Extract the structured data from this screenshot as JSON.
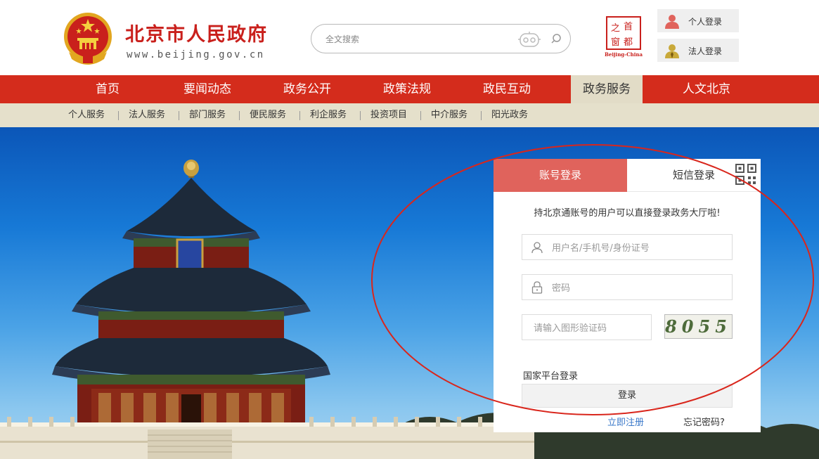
{
  "header": {
    "site_title": "北京市人民政府",
    "site_url": "www.beijing.gov.cn",
    "search_placeholder": "全文搜索",
    "personal_login": "个人登录",
    "corporate_login": "法人登录",
    "capital_logo": {
      "chars": [
        "之",
        "首",
        "窗",
        "都"
      ],
      "caption": "Beijing-China"
    }
  },
  "nav": {
    "items": [
      "首页",
      "要闻动态",
      "政务公开",
      "政策法规",
      "政民互动",
      "政务服务",
      "人文北京"
    ],
    "active": "政务服务"
  },
  "subnav": {
    "items": [
      "个人服务",
      "法人服务",
      "部门服务",
      "便民服务",
      "利企服务",
      "投资项目",
      "中介服务",
      "阳光政务"
    ]
  },
  "login": {
    "tab_account": "账号登录",
    "tab_sms": "短信登录",
    "hint": "持北京通账号的用户可以直接登录政务大厅啦!",
    "username_placeholder": "用户名/手机号/身份证号",
    "password_placeholder": "密码",
    "captcha_placeholder": "请输入图形验证码",
    "captcha_text": "8055",
    "national_login": "国家平台登录",
    "submit": "登录",
    "register": "立即注册",
    "forgot": "忘记密码?"
  },
  "colors": {
    "brand_red": "#d42c1c",
    "active_tab": "#e0635c",
    "subnav_bg": "#e5e0cb",
    "annotation": "#d9261c"
  },
  "icons": [
    "emblem",
    "robot-icon",
    "search-icon",
    "person-icon",
    "corporate-person-icon",
    "qr-code-icon",
    "user-icon",
    "lock-icon"
  ]
}
